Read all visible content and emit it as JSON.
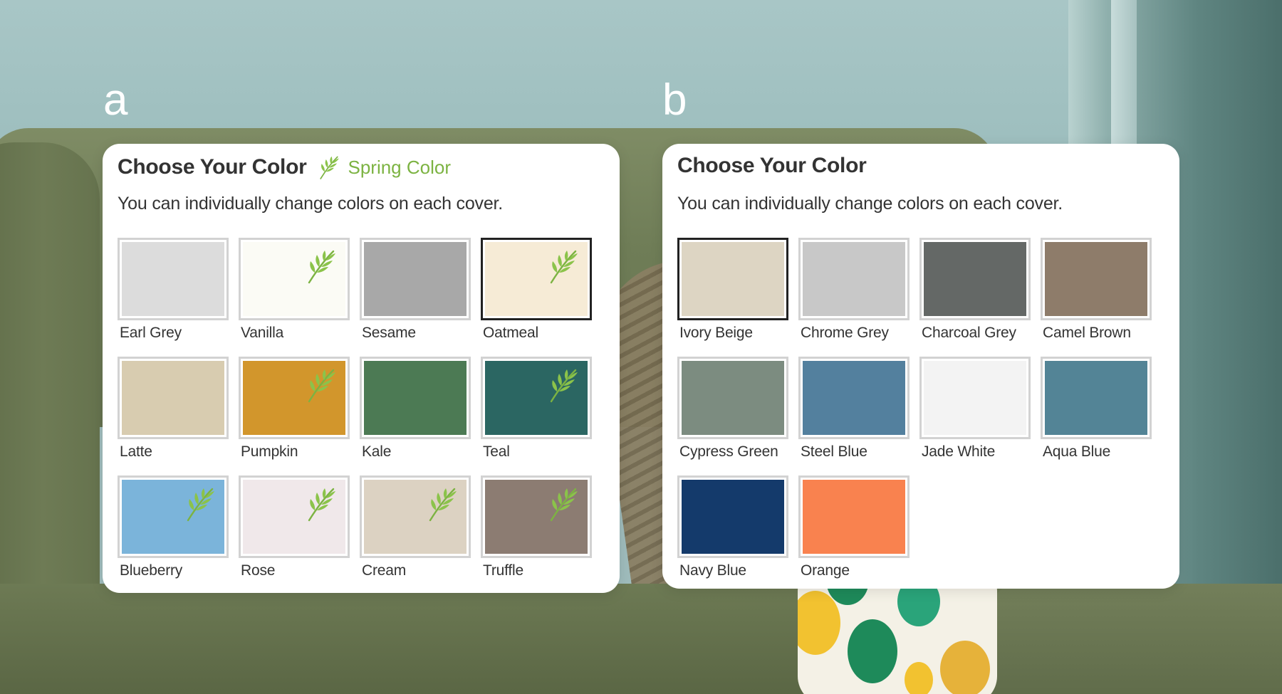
{
  "panels": [
    {
      "letter": "a",
      "title": "Choose Your Color",
      "tag": {
        "label": "Spring Color",
        "icon": "leaf-icon",
        "color": "#7cb342"
      },
      "subtitle": "You can individually change colors on each cover.",
      "swatches": [
        {
          "name": "Earl Grey",
          "color": "#dcdcdc",
          "spring": false,
          "selected": false
        },
        {
          "name": "Vanilla",
          "color": "#fbfbf5",
          "spring": true,
          "selected": false
        },
        {
          "name": "Sesame",
          "color": "#a8a8a8",
          "spring": false,
          "selected": false
        },
        {
          "name": "Oatmeal",
          "color": "#f6ebd6",
          "spring": true,
          "selected": true
        },
        {
          "name": "Latte",
          "color": "#d8ccb0",
          "spring": false,
          "selected": false
        },
        {
          "name": "Pumpkin",
          "color": "#d2962c",
          "spring": true,
          "selected": false
        },
        {
          "name": "Kale",
          "color": "#4c7a54",
          "spring": false,
          "selected": false
        },
        {
          "name": "Teal",
          "color": "#2b6662",
          "spring": true,
          "selected": false
        },
        {
          "name": "Blueberry",
          "color": "#7bb4da",
          "spring": true,
          "selected": false
        },
        {
          "name": "Rose",
          "color": "#f0e8ea",
          "spring": true,
          "selected": false
        },
        {
          "name": "Cream",
          "color": "#dcd2c2",
          "spring": true,
          "selected": false
        },
        {
          "name": "Truffle",
          "color": "#8c7c72",
          "spring": true,
          "selected": false
        }
      ]
    },
    {
      "letter": "b",
      "title": "Choose Your Color",
      "subtitle": "You can individually change colors on each cover.",
      "swatches": [
        {
          "name": "Ivory Beige",
          "color": "#ddd5c3",
          "spring": false,
          "selected": true
        },
        {
          "name": "Chrome Grey",
          "color": "#c8c8c8",
          "spring": false,
          "selected": false
        },
        {
          "name": "Charcoal Grey",
          "color": "#646866",
          "spring": false,
          "selected": false
        },
        {
          "name": "Camel Brown",
          "color": "#8e7c6a",
          "spring": false,
          "selected": false
        },
        {
          "name": "Cypress Green",
          "color": "#7c8c80",
          "spring": false,
          "selected": false
        },
        {
          "name": "Steel Blue",
          "color": "#53809e",
          "spring": false,
          "selected": false
        },
        {
          "name": "Jade White",
          "color": "#f3f3f3",
          "spring": false,
          "selected": false
        },
        {
          "name": "Aqua Blue",
          "color": "#538496",
          "spring": false,
          "selected": false
        },
        {
          "name": "Navy Blue",
          "color": "#143a6b",
          "spring": false,
          "selected": false
        },
        {
          "name": "Orange",
          "color": "#f9824f",
          "spring": false,
          "selected": false
        }
      ]
    }
  ]
}
